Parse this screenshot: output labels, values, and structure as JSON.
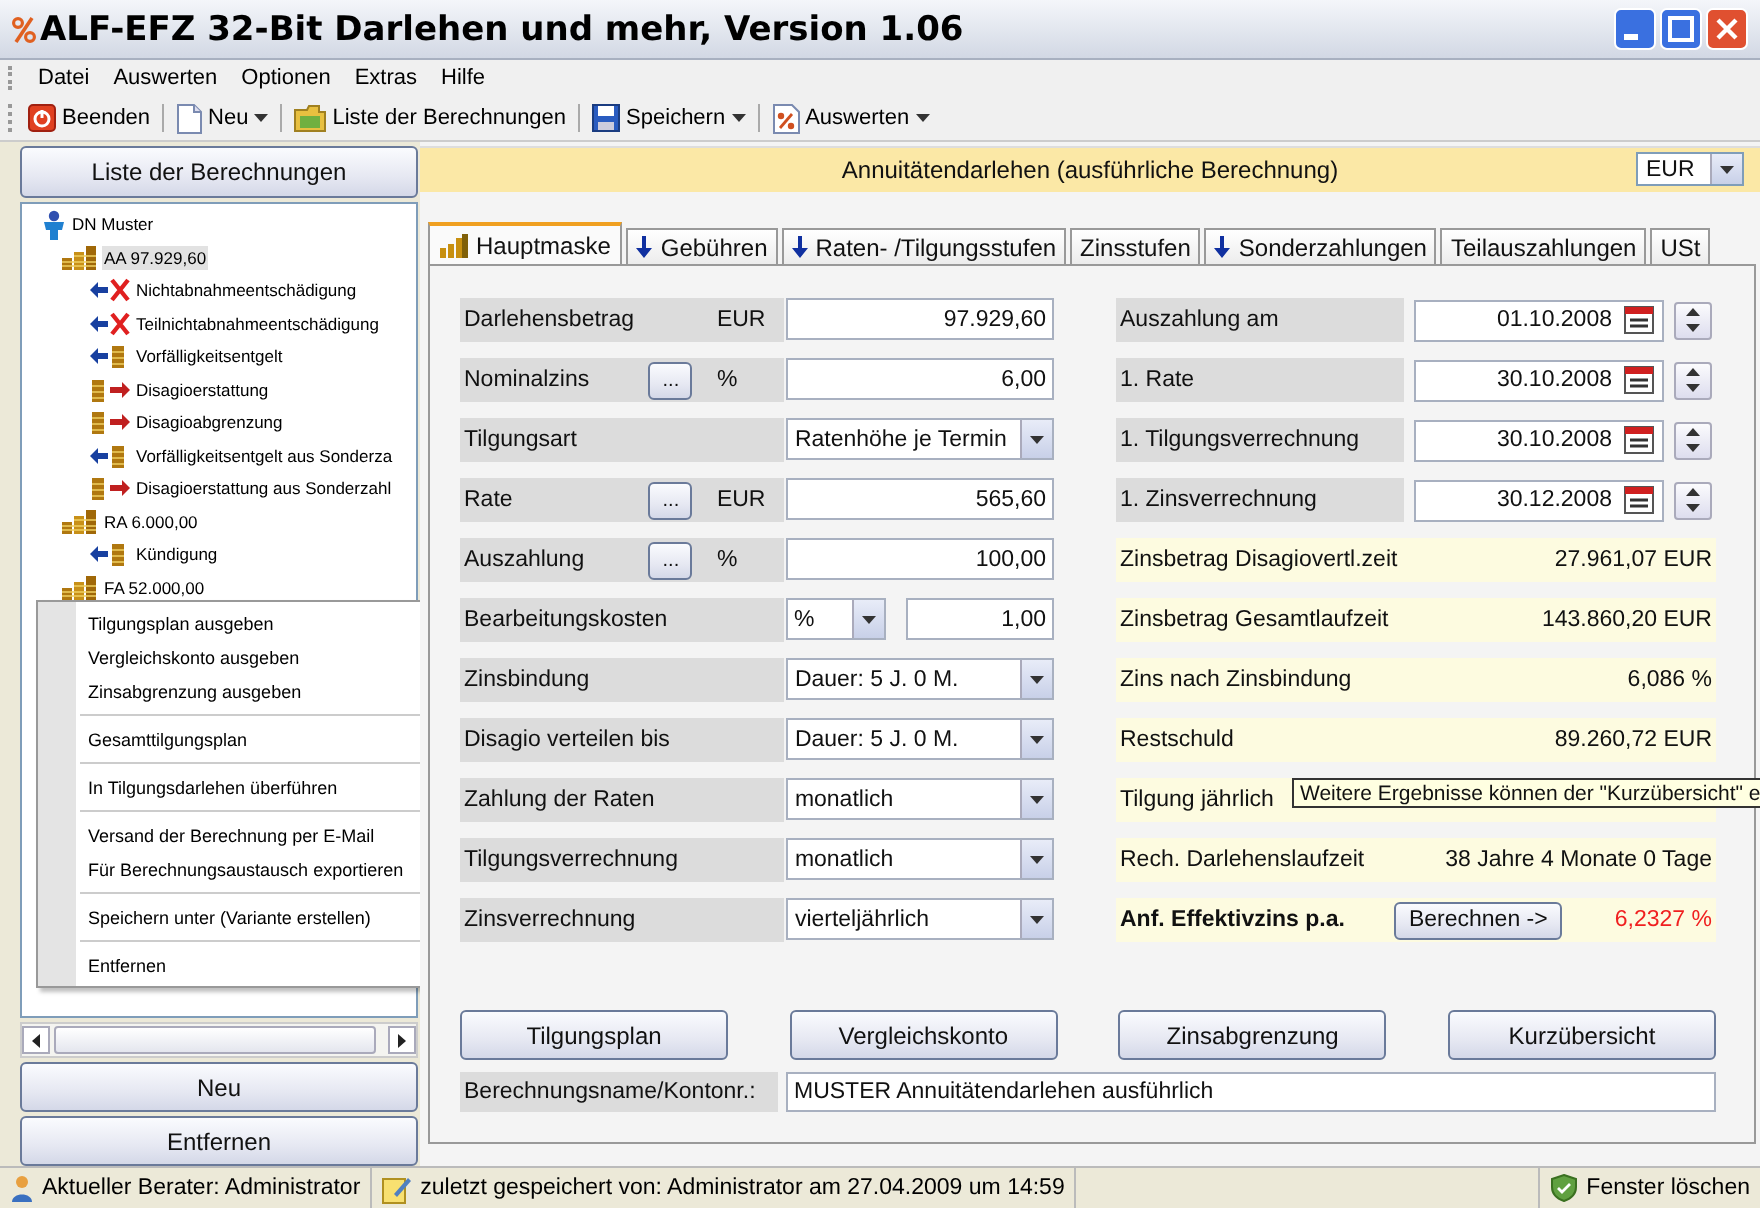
{
  "window": {
    "title": "ALF-EFZ 32-Bit Darlehen und mehr, Version 1.06"
  },
  "menu": [
    "Datei",
    "Auswerten",
    "Optionen",
    "Extras",
    "Hilfe"
  ],
  "toolbar": [
    {
      "label": "Beenden",
      "dropdown": false
    },
    {
      "label": "Neu",
      "dropdown": true
    },
    {
      "label": "Liste der Berechnungen",
      "dropdown": false
    },
    {
      "label": "Speichern",
      "dropdown": true
    },
    {
      "label": "Auswerten",
      "dropdown": true
    }
  ],
  "sidebar": {
    "header_button": "Liste der Berechnungen",
    "tree": [
      {
        "label": "DN Muster",
        "kind": "person",
        "selected": false,
        "children": [
          {
            "label": "AA 97.929,60",
            "kind": "account",
            "selected": true,
            "children": [
              {
                "label": "Nichtabnahmeentschädigung",
                "kind": "penalty",
                "selected": false
              },
              {
                "label": "Teilnichtabnahmeentschädigung",
                "kind": "penalty",
                "selected": false
              },
              {
                "label": "Vorfälligkeitsentgelt",
                "kind": "fee",
                "selected": false
              },
              {
                "label": "Disagioerstattung",
                "kind": "refund",
                "selected": false
              },
              {
                "label": "Disagioabgrenzung",
                "kind": "refund",
                "selected": false
              },
              {
                "label": "Vorfälligkeitsentgelt aus Sonderza",
                "kind": "fee",
                "selected": false
              },
              {
                "label": "Disagioerstattung aus Sonderzahl",
                "kind": "refund",
                "selected": false
              }
            ]
          },
          {
            "label": "RA 6.000,00",
            "kind": "account",
            "selected": false,
            "children": [
              {
                "label": "Kündigung",
                "kind": "fee",
                "selected": false
              }
            ]
          },
          {
            "label": "FA 52.000,00",
            "kind": "account",
            "selected": false
          }
        ]
      }
    ],
    "buttons": [
      "Neu",
      "Entfernen"
    ]
  },
  "context_menu": [
    [
      "Tilgungsplan ausgeben",
      "Vergleichskonto ausgeben",
      "Zinsabgrenzung ausgeben"
    ],
    [
      "Gesamttilgungsplan"
    ],
    [
      "In Tilgungsdarlehen überführen"
    ],
    [
      "Versand der Berechnung per E-Mail",
      "Für Berechnungsaustausch exportieren"
    ],
    [
      "Speichern unter (Variante erstellen)"
    ],
    [
      "Entfernen"
    ]
  ],
  "header": {
    "title": "Annuitätendarlehen (ausführliche Berechnung)",
    "currency": "EUR"
  },
  "tabs": [
    {
      "label": "Hauptmaske",
      "selected": true
    },
    {
      "label": "Gebühren",
      "selected": false
    },
    {
      "label": "Raten- /Tilgungsstufen",
      "selected": false
    },
    {
      "label": "Zinsstufen",
      "selected": false
    },
    {
      "label": "Sonderzahlungen",
      "selected": false
    },
    {
      "label": "Teilauszahlungen",
      "selected": false
    },
    {
      "label": "USt",
      "selected": false
    }
  ],
  "form": {
    "left": [
      {
        "label": "Darlehensbetrag",
        "unit": "EUR",
        "kind": "input",
        "value": "97.929,60"
      },
      {
        "label": "Nominalzins",
        "picker": "...",
        "unit": "%",
        "kind": "input",
        "value": "6,00"
      },
      {
        "label": "Tilgungsart",
        "kind": "select",
        "value": "Ratenhöhe je Termin"
      },
      {
        "label": "Rate",
        "picker": "...",
        "unit": "EUR",
        "kind": "input",
        "value": "565,60"
      },
      {
        "label": "Auszahlung",
        "picker": "...",
        "unit": "%",
        "kind": "input",
        "value": "100,00"
      },
      {
        "label": "Bearbeitungskosten",
        "kind": "unit-select",
        "unit": "%",
        "value": "1,00"
      },
      {
        "label": "Zinsbindung",
        "kind": "select",
        "value": "Dauer: 5 J. 0 M."
      },
      {
        "label": "Disagio verteilen bis",
        "kind": "select",
        "value": "Dauer: 5 J. 0 M."
      },
      {
        "label": "Zahlung der Raten",
        "kind": "select",
        "value": "monatlich"
      },
      {
        "label": "Tilgungsverrechnung",
        "kind": "select",
        "value": "monatlich"
      },
      {
        "label": "Zinsverrechnung",
        "kind": "select",
        "value": "vierteljährlich"
      }
    ],
    "right": [
      {
        "label": "Auszahlung am",
        "kind": "date",
        "value": "01.10.2008"
      },
      {
        "label": "1. Rate",
        "kind": "date",
        "value": "30.10.2008"
      },
      {
        "label": "1. Tilgungsverrechnung",
        "kind": "date",
        "value": "30.10.2008"
      },
      {
        "label": "1. Zinsverrechnung",
        "kind": "date",
        "value": "30.12.2008"
      },
      {
        "label": "Zinsbetrag Disagiovertl.zeit",
        "kind": "result",
        "value": "27.961,07 EUR"
      },
      {
        "label": "Zinsbetrag Gesamtlaufzeit",
        "kind": "result",
        "value": "143.860,20 EUR"
      },
      {
        "label": "Zins nach Zinsbindung",
        "kind": "result",
        "value": "6,086 %"
      },
      {
        "label": "Restschuld",
        "kind": "result",
        "value": "89.260,72 EUR"
      },
      {
        "label": "Tilgung jährlich",
        "kind": "result"
      },
      {
        "label": "Rech. Darlehenslaufzeit",
        "kind": "result",
        "value": "38 Jahre 4 Monate 0 Tage"
      },
      {
        "label": "Anf. Effektivzins p.a.",
        "kind": "action",
        "button": "Berechnen ->",
        "value": "6,2327 %"
      }
    ]
  },
  "tooltip": "Weitere Ergebnisse können der \"Kurzübersicht\" e",
  "actions": [
    "Tilgungsplan",
    "Vergleichskonto",
    "Zinsabgrenzung",
    "Kurzübersicht"
  ],
  "name_field": {
    "label": "Berechnungsname/Kontonr.:",
    "value": "MUSTER Annuitätendarlehen ausführlich"
  },
  "status_bar": {
    "items": [
      "Aktueller Berater: Administrator",
      "zuletzt gespeichert von: Administrator am 27.04.2009 um 14:59"
    ],
    "right": "Fenster löschen"
  }
}
